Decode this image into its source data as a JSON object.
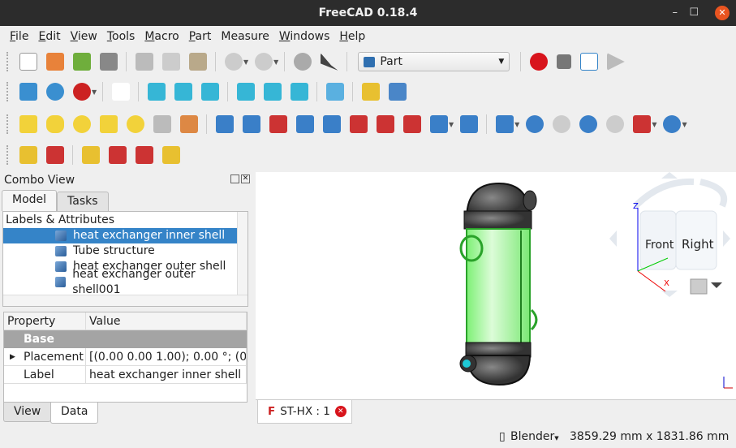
{
  "window": {
    "title": "FreeCAD 0.18.4",
    "minimize": "–",
    "maximize": "☐",
    "close": "✕"
  },
  "menu": [
    {
      "u": "F",
      "rest": "ile"
    },
    {
      "u": "E",
      "rest": "dit"
    },
    {
      "u": "V",
      "rest": "iew"
    },
    {
      "u": "T",
      "rest": "ools"
    },
    {
      "u": "M",
      "rest": "acro"
    },
    {
      "u": "P",
      "rest": "art"
    },
    {
      "u": "",
      "rest": "Measure"
    },
    {
      "u": "W",
      "rest": "indows"
    },
    {
      "u": "H",
      "rest": "elp"
    }
  ],
  "toolbar": {
    "workbench": "Part"
  },
  "combo": {
    "title": "Combo View",
    "tabs": [
      "Model",
      "Tasks"
    ],
    "tree_header": "Labels & Attributes",
    "items": [
      "heat exchanger inner shell",
      "Tube structure",
      "heat exchanger outer shell",
      "heat exchanger outer shell001"
    ],
    "prop_headers": [
      "Property",
      "Value"
    ],
    "group": "Base",
    "props": [
      {
        "name": "Placement",
        "value": "[(0.00 0.00 1.00); 0.00 °; (0…"
      },
      {
        "name": "Label",
        "value": "heat exchanger inner shell"
      }
    ],
    "bottom_tabs": [
      "View",
      "Data"
    ]
  },
  "navcube": {
    "front": "Front",
    "right": "Right",
    "z": "Z",
    "x": "X"
  },
  "doc_tab": "ST-HX : 1",
  "status": {
    "nav_style": "Blender",
    "dimensions": "3859.29 mm x 1831.86 mm"
  },
  "colors": {
    "selection": "#3584c8",
    "shell": "#9ff59a",
    "accent": "#e95420"
  }
}
